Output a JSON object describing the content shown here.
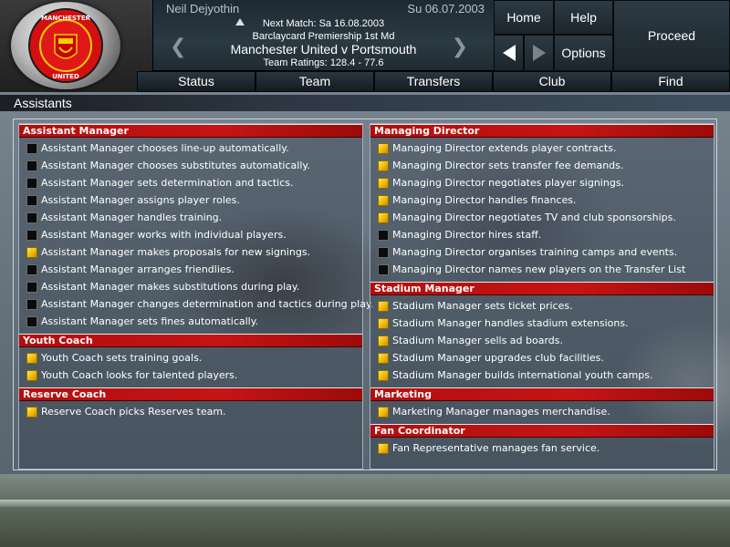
{
  "header": {
    "manager_name": "Neil Dejyothin",
    "current_date": "Su 06.07.2003",
    "next_match": "Next Match: Sa 16.08.2003",
    "competition": "Barclaycard Premiership 1st Md",
    "fixture": "Manchester United v Portsmouth",
    "ratings": "Team Ratings: 128.4 - 77.6",
    "club_logo_text": "MANCHESTER UNITED"
  },
  "nav": {
    "home": "Home",
    "help": "Help",
    "options": "Options",
    "proceed": "Proceed"
  },
  "menu": [
    "Status",
    "Team",
    "Transfers",
    "Club",
    "Find"
  ],
  "page_title": "Assistants",
  "left_column": [
    {
      "title": "Assistant Manager",
      "items": [
        {
          "label": "Assistant Manager chooses line-up automatically.",
          "checked": false
        },
        {
          "label": "Assistant Manager chooses substitutes automatically.",
          "checked": false
        },
        {
          "label": "Assistant Manager sets determination and tactics.",
          "checked": false
        },
        {
          "label": "Assistant Manager assigns player roles.",
          "checked": false
        },
        {
          "label": "Assistant Manager handles training.",
          "checked": false
        },
        {
          "label": "Assistant Manager works with individual players.",
          "checked": false
        },
        {
          "label": "Assistant Manager makes proposals for new signings.",
          "checked": true
        },
        {
          "label": "Assistant Manager arranges friendlies.",
          "checked": false
        },
        {
          "label": "Assistant Manager makes substitutions during play.",
          "checked": false
        },
        {
          "label": "Assistant Manager changes determination and tactics during play.",
          "checked": false
        },
        {
          "label": "Assistant Manager sets fines automatically.",
          "checked": false
        }
      ]
    },
    {
      "title": "Youth Coach",
      "items": [
        {
          "label": "Youth Coach sets training goals.",
          "checked": true
        },
        {
          "label": "Youth Coach looks for talented players.",
          "checked": true
        }
      ]
    },
    {
      "title": "Reserve Coach",
      "items": [
        {
          "label": "Reserve Coach picks Reserves team.",
          "checked": true
        }
      ]
    }
  ],
  "right_column": [
    {
      "title": "Managing Director",
      "items": [
        {
          "label": "Managing Director extends player contracts.",
          "checked": true
        },
        {
          "label": "Managing Director sets transfer fee demands.",
          "checked": true
        },
        {
          "label": "Managing Director negotiates player signings.",
          "checked": true
        },
        {
          "label": "Managing Director handles finances.",
          "checked": true
        },
        {
          "label": "Managing Director negotiates TV and club sponsorships.",
          "checked": true
        },
        {
          "label": "Managing Director hires staff.",
          "checked": false
        },
        {
          "label": "Managing Director organises training camps and events.",
          "checked": false
        },
        {
          "label": "Managing Director names new players on the Transfer List",
          "checked": false
        }
      ]
    },
    {
      "title": "Stadium Manager",
      "items": [
        {
          "label": "Stadium Manager sets ticket prices.",
          "checked": true
        },
        {
          "label": "Stadium Manager handles stadium extensions.",
          "checked": true
        },
        {
          "label": "Stadium Manager sells ad boards.",
          "checked": true
        },
        {
          "label": "Stadium Manager upgrades club facilities.",
          "checked": true
        },
        {
          "label": "Stadium Manager builds international youth camps.",
          "checked": true
        }
      ]
    },
    {
      "title": "Marketing",
      "items": [
        {
          "label": "Marketing Manager manages merchandise.",
          "checked": true
        }
      ]
    },
    {
      "title": "Fan Coordinator",
      "items": [
        {
          "label": "Fan Representative manages fan service.",
          "checked": true
        }
      ]
    }
  ],
  "colors": {
    "section_red": "#c51414",
    "checkbox_on": "#f0b800",
    "checkbox_off": "#0b0b0b"
  }
}
